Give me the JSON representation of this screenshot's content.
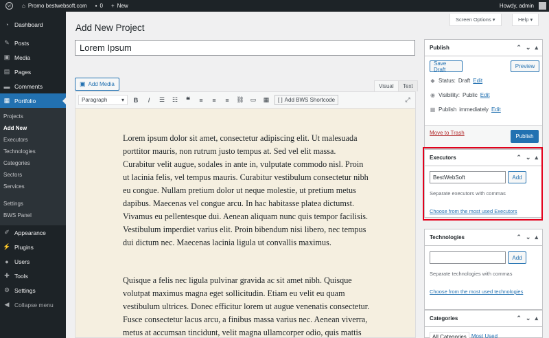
{
  "adminbar": {
    "site": "Promo bestwebsoft.com",
    "comments": "0",
    "new": "New",
    "howdy": "Howdy, admin"
  },
  "sidebar": {
    "items": [
      {
        "label": "Dashboard",
        "icon": "dashboard-icon"
      },
      {
        "label": "Posts",
        "icon": "pin-icon"
      },
      {
        "label": "Media",
        "icon": "media-icon"
      },
      {
        "label": "Pages",
        "icon": "pages-icon"
      },
      {
        "label": "Comments",
        "icon": "comments-icon"
      },
      {
        "label": "Portfolio",
        "icon": "portfolio-icon"
      }
    ],
    "submenu": [
      "Projects",
      "Add New",
      "Executors",
      "Technologies",
      "Categories",
      "Sectors",
      "Services",
      "Settings",
      "BWS Panel"
    ],
    "items2": [
      {
        "label": "Appearance",
        "icon": "appearance-icon"
      },
      {
        "label": "Plugins",
        "icon": "plugins-icon"
      },
      {
        "label": "Users",
        "icon": "users-icon"
      },
      {
        "label": "Tools",
        "icon": "tools-icon"
      },
      {
        "label": "Settings",
        "icon": "settings-icon"
      },
      {
        "label": "Collapse menu",
        "icon": "collapse-icon"
      }
    ]
  },
  "header": {
    "title": "Add New Project",
    "screen_options": "Screen Options ▾",
    "help": "Help ▾"
  },
  "editor": {
    "title_value": "Lorem Ipsum",
    "add_media": "Add Media",
    "tab_visual": "Visual",
    "tab_text": "Text",
    "format": "Paragraph",
    "bws_shortcode": "Add BWS Shortcode",
    "para1": "Lorem ipsum dolor sit amet, consectetur adipiscing elit. Ut malesuada porttitor mauris, non rutrum justo tempus at. Sed vel elit massa. Curabitur velit augue, sodales in ante in, vulputate commodo nisl. Proin ut lacinia felis, vel tempus mauris. Curabitur vestibulum consectetur nibh eu congue. Nullam pretium dolor ut neque molestie, ut pretium metus dapibus. Maecenas vel congue arcu. In hac habitasse platea dictumst. Vivamus eu pellentesque dui. Aenean aliquam nunc quis tempor facilisis. Vestibulum imperdiet varius elit. Proin bibendum nisi libero, nec tempus dui dictum nec. Maecenas lacinia ligula ut convallis maximus.",
    "para2": "Quisque a felis nec ligula pulvinar gravida ac sit amet nibh. Quisque volutpat maximus magna eget sollicitudin. Etiam eu velit eu quam vestibulum ultrices. Donec efficitur lorem ut augue venenatis consectetur. Fusce consectetur lacus arcu, a finibus massa varius nec. Aenean viverra, metus at accumsan tincidunt, velit magna ullamcorper odio, quis mattis arcu tortor in nisl. Donec eleifend"
  },
  "publish": {
    "title": "Publish",
    "save_draft": "Save Draft",
    "preview": "Preview",
    "status_label": "Status:",
    "status_value": "Draft",
    "visibility_label": "Visibility:",
    "visibility_value": "Public",
    "publish_label": "Publish",
    "publish_value": "immediately",
    "edit": "Edit",
    "trash": "Move to Trash",
    "publish_btn": "Publish"
  },
  "executors": {
    "title": "Executors",
    "value": "BestWebSoft",
    "add": "Add",
    "help": "Separate executors with commas",
    "choose": "Choose from the most used Executors"
  },
  "technologies": {
    "title": "Technologies",
    "value": "",
    "add": "Add",
    "help": "Separate technologies with commas",
    "choose": "Choose from the most used technologies"
  },
  "categories": {
    "title": "Categories",
    "tab_all": "All Categories",
    "tab_most": "Most Used"
  },
  "colors": {
    "accent": "#2271b1",
    "highlight": "#e3001b",
    "sidebar": "#1d2327",
    "editor_bg": "#f5efe0"
  }
}
